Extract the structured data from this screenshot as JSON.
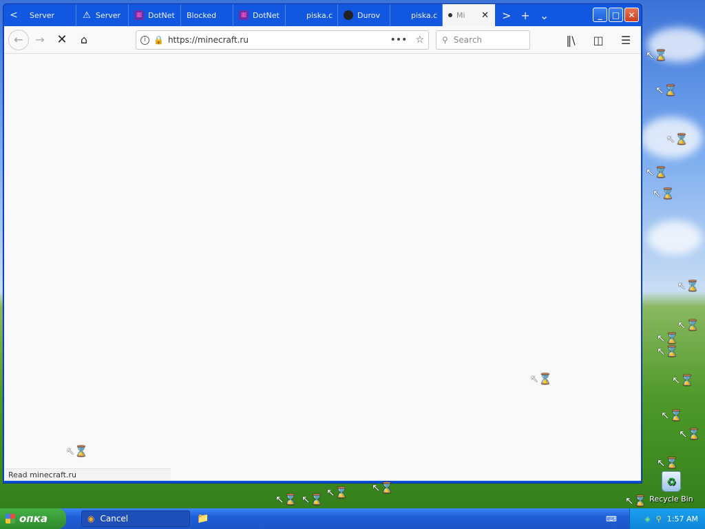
{
  "browser": {
    "tabs": [
      {
        "label": "Server",
        "icon": "back-arrow-icon"
      },
      {
        "label": "Server",
        "icon": "warning-icon"
      },
      {
        "label": "DotNet",
        "icon": "dotnet-icon"
      },
      {
        "label": "Blocked",
        "icon": ""
      },
      {
        "label": "DotNet",
        "icon": "dotnet-icon"
      },
      {
        "label": "piska.c",
        "icon": ""
      },
      {
        "label": "Durov",
        "icon": "durov-icon"
      },
      {
        "label": "piska.c",
        "icon": ""
      },
      {
        "label": "Mi",
        "icon": "loading-dot-icon",
        "active": true
      }
    ],
    "url": "https://minecraft.ru",
    "search_placeholder": "Search",
    "status_text": "Read minecraft.ru"
  },
  "desktop": {
    "recycle_bin_label": "Recycle Bin"
  },
  "taskbar": {
    "start_label": "опка",
    "task_cancel_label": "Cancel",
    "clock": "1:57 AM"
  },
  "colors": {
    "titlebar": "#1257e0",
    "start_green": "#2e8a2e",
    "tray_blue": "#0e85d8"
  }
}
